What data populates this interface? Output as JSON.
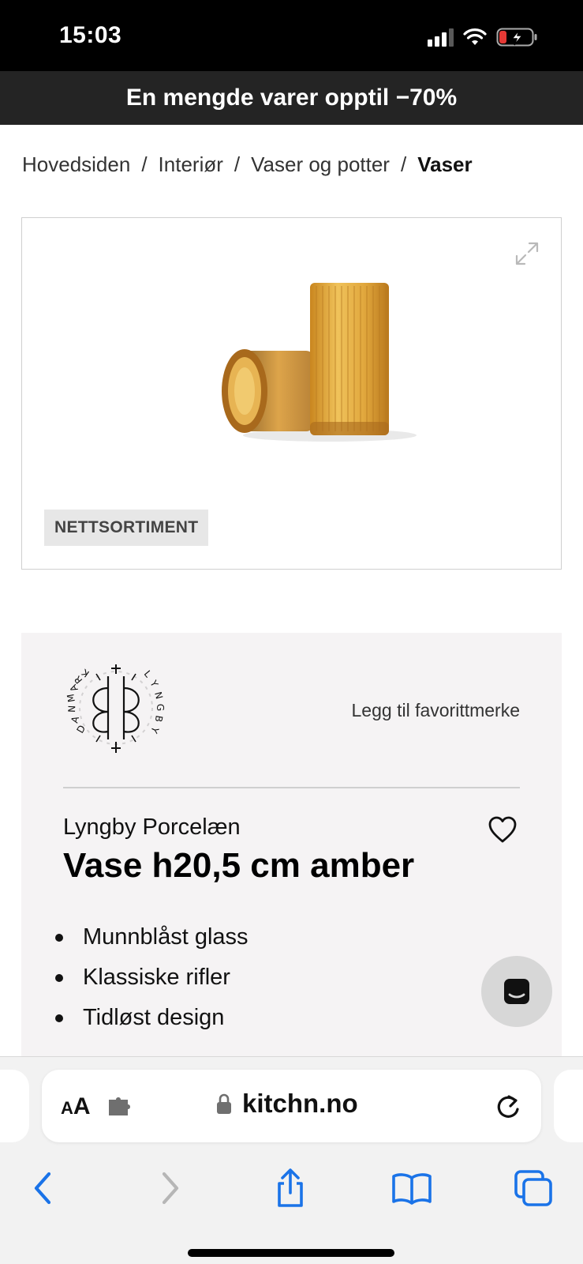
{
  "status_bar": {
    "time": "15:03"
  },
  "promo": {
    "text": "En mengde varer opptil −70%"
  },
  "breadcrumb": {
    "items": [
      "Hovedsiden",
      "Interiør",
      "Vaser og potter"
    ],
    "current": "Vaser",
    "separator": "/"
  },
  "product_image": {
    "alt": "Amber ribbed glass vase, standing and lying",
    "tag": "NETTSORTIMENT"
  },
  "info": {
    "logo_text": "DANMARK LYNGBY",
    "favorite_link": "Legg til favorittmerke",
    "brand": "Lyngby Porcelæn",
    "title": "Vase h20,5 cm amber",
    "features": [
      "Munnblåst glass",
      "Klassiske rifler",
      "Tidløst design"
    ]
  },
  "browser": {
    "aa_small": "A",
    "aa_big": "A",
    "url": "kitchn.no"
  },
  "colors": {
    "promo_bg": "#242424",
    "panel_bg": "#f5f3f4",
    "ios_blue": "#1a73e8",
    "amber": "#d9a23a",
    "battery_red": "#e53935"
  }
}
